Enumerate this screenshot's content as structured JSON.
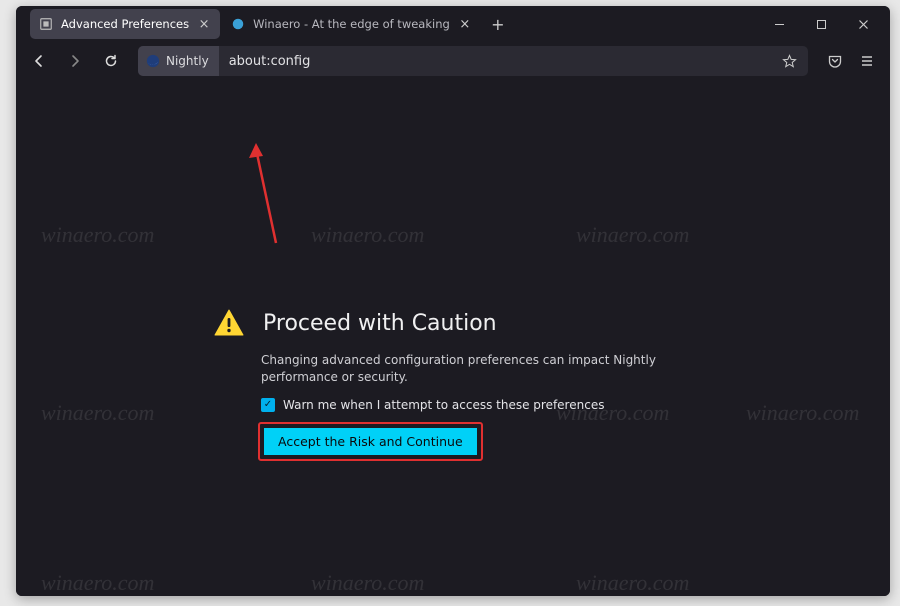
{
  "tabs": [
    {
      "title": "Advanced Preferences",
      "active": true
    },
    {
      "title": "Winaero - At the edge of tweaking",
      "active": false
    }
  ],
  "identity": {
    "label": "Nightly"
  },
  "url": "about:config",
  "warning": {
    "title": "Proceed with Caution",
    "description": "Changing advanced configuration preferences can impact Nightly performance or security.",
    "checkbox_label": "Warn me when I attempt to access these preferences",
    "accept_label": "Accept the Risk and Continue"
  },
  "watermark": "winaero.com"
}
